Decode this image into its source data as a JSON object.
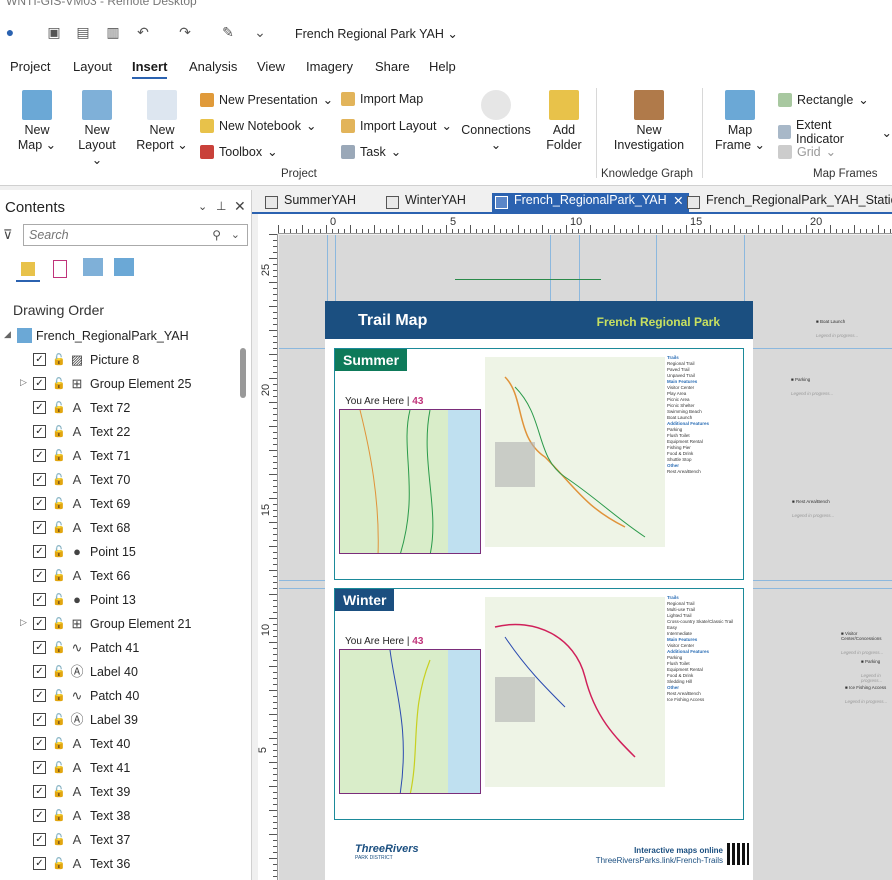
{
  "window": {
    "title": "WNTI-GIS-VM03 - Remote Desktop"
  },
  "quick_access": {
    "project_title": "French Regional Park YAH"
  },
  "menu_tabs": [
    "Project",
    "Layout",
    "Insert",
    "Analysis",
    "View",
    "Imagery",
    "Share",
    "Help"
  ],
  "active_tab": "Insert",
  "ribbon": {
    "new_map": "New Map",
    "new_layout": "New Layout",
    "new_report": "New Report",
    "new_presentation": "New Presentation",
    "new_notebook": "New Notebook",
    "toolbox": "Toolbox",
    "import_map": "Import Map",
    "import_layout": "Import Layout",
    "task": "Task",
    "connections": "Connections",
    "add_folder": "Add Folder",
    "new_investigation": "New Investigation",
    "map_frame": "Map Frame",
    "rectangle": "Rectangle",
    "extent_indicator": "Extent Indicator",
    "grid": "Grid",
    "group_project": "Project",
    "group_knowledge": "Knowledge Graph",
    "group_mapframes": "Map Frames"
  },
  "contents": {
    "title": "Contents",
    "search_placeholder": "Search",
    "drawing_order": "Drawing Order",
    "root": "French_RegionalPark_YAH",
    "items": [
      {
        "name": "Picture 8",
        "type": "picture",
        "expand": false
      },
      {
        "name": "Group Element 25",
        "type": "group",
        "expand": true
      },
      {
        "name": "Text 72",
        "type": "text",
        "expand": false
      },
      {
        "name": "Text 22",
        "type": "text",
        "expand": false
      },
      {
        "name": "Text 71",
        "type": "text",
        "expand": false
      },
      {
        "name": "Text 70",
        "type": "text",
        "expand": false
      },
      {
        "name": "Text 69",
        "type": "text",
        "expand": false
      },
      {
        "name": "Text 68",
        "type": "text",
        "expand": false
      },
      {
        "name": "Point 15",
        "type": "point",
        "expand": false
      },
      {
        "name": "Text 66",
        "type": "text",
        "expand": false
      },
      {
        "name": "Point 13",
        "type": "point",
        "expand": false
      },
      {
        "name": "Group Element 21",
        "type": "group",
        "expand": true
      },
      {
        "name": "Patch 41",
        "type": "patch",
        "expand": false
      },
      {
        "name": "Label 40",
        "type": "label",
        "expand": false
      },
      {
        "name": "Patch 40",
        "type": "patch",
        "expand": false
      },
      {
        "name": "Label 39",
        "type": "label",
        "expand": false
      },
      {
        "name": "Text 40",
        "type": "text",
        "expand": false
      },
      {
        "name": "Text 41",
        "type": "text",
        "expand": false
      },
      {
        "name": "Text 39",
        "type": "text",
        "expand": false
      },
      {
        "name": "Text 38",
        "type": "text",
        "expand": false
      },
      {
        "name": "Text 37",
        "type": "text",
        "expand": false
      },
      {
        "name": "Text 36",
        "type": "text",
        "expand": false
      }
    ]
  },
  "view_tabs": [
    {
      "label": "SummerYAH"
    },
    {
      "label": "WinterYAH"
    },
    {
      "label": "French_RegionalPark_YAH"
    },
    {
      "label": "French_RegionalPark_YAH_StaticM"
    }
  ],
  "ruler": {
    "h": [
      "0",
      "5",
      "10",
      "15",
      "20"
    ],
    "v": [
      "25",
      "20",
      "15",
      "10",
      "5"
    ]
  },
  "layout": {
    "header": "Trail Map",
    "park": "French Regional Park",
    "summer": "Summer",
    "winter": "Winter",
    "you_are_here": "You Are Here",
    "summer_page": "43",
    "winter_page": "43",
    "footer_brand": "ThreeRivers",
    "footer_sub": "PARK DISTRICT",
    "footer_online": "Interactive maps online",
    "footer_url": "ThreeRiversParks.link/French-Trails",
    "summer_legend": [
      "Trails",
      "Regional Trail",
      "Paved Trail",
      "Unpaved Trail",
      "Main Features",
      "Visitor Center",
      "Play Area",
      "Picnic Area",
      "Picnic Shelter",
      "Swimming Beach",
      "Boat Launch",
      "Additional Features",
      "Parking",
      "Flush Toilet",
      "Equipment Rental",
      "Fishing Pier",
      "Food & Drink",
      "Shuttle Stop",
      "Other",
      "Rest Area/Bench"
    ],
    "winter_legend": [
      "Trails",
      "Regional Trail",
      "Multi-use Trail",
      "Lighted Trail",
      "Cross-country Skate/Classic Trail",
      "Easy",
      "Intermediate",
      "Main Features",
      "Visitor Center",
      "Additional Features",
      "Parking",
      "Flush Toilet",
      "Equipment Rental",
      "Food & Drink",
      "Sledding Hill",
      "Other",
      "Rest Area/Bench",
      "Ice Fishing Access"
    ]
  },
  "side_labels": [
    {
      "label": "Boat Launch",
      "sub": "Legend in progress..."
    },
    {
      "label": "Parking",
      "sub": "Legend in progress..."
    },
    {
      "label": "Rest Area/Bench",
      "sub": "Legend in progress..."
    },
    {
      "label": "Visitor Center/Concessions",
      "sub": "Legend in progress..."
    },
    {
      "label": "Parking",
      "sub": "Legend in progress..."
    },
    {
      "label": "Ice Fishing Access",
      "sub": "Legend in progress..."
    }
  ]
}
